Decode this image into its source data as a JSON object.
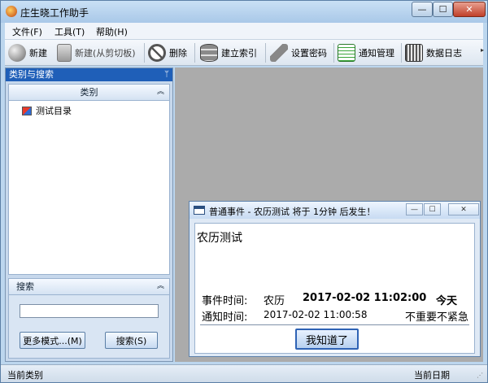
{
  "window": {
    "title": "庄生晓工作助手",
    "min_glyph": "—",
    "max_glyph": "☐",
    "close_glyph": "✕"
  },
  "menu": [
    "文件(F)",
    "工具(T)",
    "帮助(H)"
  ],
  "toolbar": {
    "new_label": "新建",
    "new_clipboard_label": "新建(从剪切板)",
    "delete_label": "删除",
    "build_index_label": "建立索引",
    "set_password_label": "设置密码",
    "notify_manage_label": "通知管理",
    "data_log_label": "数据日志",
    "more_glyph": "▸"
  },
  "left_panel": {
    "header": "类别与搜索",
    "pin_glyph": "ᛘ",
    "category_title": "类别",
    "category_chevron": "︽",
    "tree_items": [
      "测试目录"
    ],
    "search_title": "搜索",
    "search_chevron": "︽",
    "search_value": "",
    "more_modes_button": "更多模式...(M)",
    "search_button": "搜索(S)"
  },
  "popup": {
    "title": "普通事件 - 农历测试 将于 1分钟 后发生！",
    "min_glyph": "—",
    "max_glyph": "☐",
    "close_glyph": "✕",
    "subject": "农历测试",
    "event_time_label": "事件时间:",
    "calendar_type": "农历",
    "event_time": "2017-02-02  11:02:00",
    "event_day": "今天",
    "notify_time_label": "通知时间:",
    "notify_time": "2017-02-02  11:00:58",
    "priority": "不重要不紧急",
    "ok_button": "我知道了"
  },
  "status": {
    "left": "当前类别",
    "right": "当前日期",
    "grip_glyph": "⋰"
  },
  "colors": {
    "panel_header": "#1f5fb8",
    "main_background": "#ababab",
    "window_frame": "#bcd6ee"
  }
}
